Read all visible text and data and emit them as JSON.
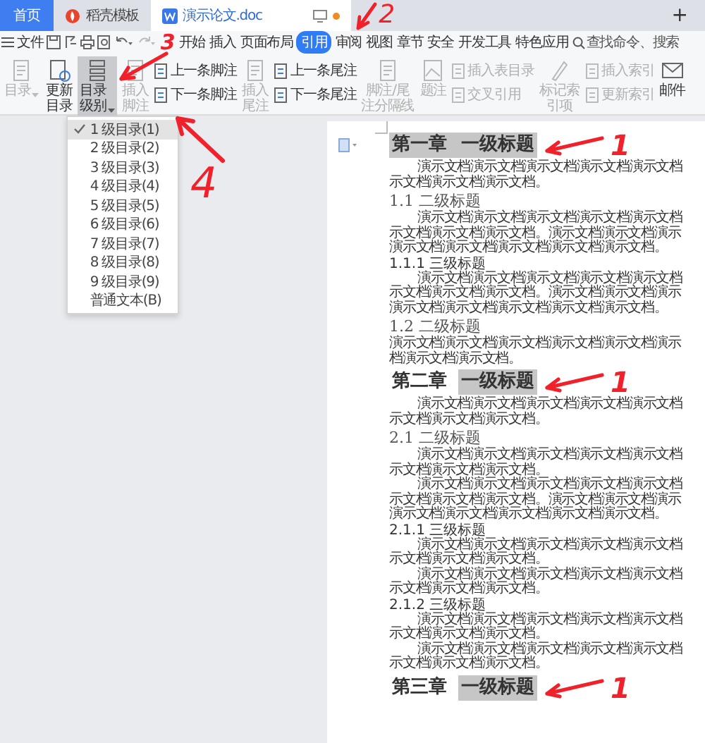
{
  "window_tabs": [
    {
      "kind": "home",
      "label": "首页",
      "selected": false
    },
    {
      "kind": "template",
      "label": "稻壳模板",
      "selected": false
    },
    {
      "kind": "document",
      "label": "演示论文.doc",
      "selected": true
    }
  ],
  "new_tab": "+",
  "menu": {
    "file": "文件",
    "tabs": [
      {
        "label": "开始",
        "selected": false
      },
      {
        "label": "插入",
        "selected": false
      },
      {
        "label": "页面布局",
        "selected": false
      },
      {
        "label": "引用",
        "selected": true
      },
      {
        "label": "审阅",
        "selected": false
      },
      {
        "label": "视图",
        "selected": false
      },
      {
        "label": "章节",
        "selected": false
      },
      {
        "label": "安全",
        "selected": false
      },
      {
        "label": "开发工具",
        "selected": false
      },
      {
        "label": "特色应用",
        "selected": false
      }
    ],
    "search": {
      "placeholder": "查找命令、搜索"
    }
  },
  "ribbon": [
    {
      "kind": "large",
      "label": "目录",
      "disabled": true,
      "pressed": false,
      "dropdown": true
    },
    {
      "kind": "large",
      "label": "更新目录",
      "disabled": false,
      "pressed": false,
      "dropdown": false
    },
    {
      "kind": "large",
      "label": "目录级别",
      "disabled": false,
      "pressed": true,
      "dropdown": true
    },
    {
      "kind": "large",
      "label": "插入脚注",
      "disabled": true,
      "pressed": false,
      "dropdown": false
    },
    {
      "kind": "stack",
      "items": [
        {
          "label": "上一条脚注",
          "disabled": false
        },
        {
          "label": "下一条脚注",
          "disabled": false
        }
      ]
    },
    {
      "kind": "large",
      "label": "插入尾注",
      "disabled": true,
      "pressed": false,
      "dropdown": false
    },
    {
      "kind": "stack",
      "items": [
        {
          "label": "上一条尾注",
          "disabled": false
        },
        {
          "label": "下一条尾注",
          "disabled": false
        }
      ]
    },
    {
      "kind": "large",
      "label": "脚注/尾注分隔线",
      "disabled": true,
      "pressed": false,
      "dropdown": false
    },
    {
      "kind": "large",
      "label": "题注",
      "disabled": true,
      "pressed": false,
      "dropdown": false
    },
    {
      "kind": "stack",
      "items": [
        {
          "label": "插入表目录",
          "disabled": true
        },
        {
          "label": "交叉引用",
          "disabled": true
        }
      ]
    },
    {
      "kind": "large",
      "label": "标记索引项",
      "disabled": true,
      "pressed": false,
      "dropdown": false
    },
    {
      "kind": "stack",
      "items": [
        {
          "label": "插入索引",
          "disabled": true
        },
        {
          "label": "更新索引",
          "disabled": true
        }
      ]
    },
    {
      "kind": "large",
      "label": "邮件",
      "disabled": false,
      "pressed": false,
      "dropdown": false
    }
  ],
  "toc_level_menu": {
    "items": [
      {
        "label": "1 级目录(1)",
        "checked": true
      },
      {
        "label": "2 级目录(2)",
        "checked": false
      },
      {
        "label": "3 级目录(3)",
        "checked": false
      },
      {
        "label": "4 级目录(4)",
        "checked": false
      },
      {
        "label": "5 级目录(5)",
        "checked": false
      },
      {
        "label": "6 级目录(6)",
        "checked": false
      },
      {
        "label": "7 级目录(7)",
        "checked": false
      },
      {
        "label": "8 级目录(8)",
        "checked": false
      },
      {
        "label": "9 级目录(9)",
        "checked": false
      },
      {
        "label": "普通文本(B)",
        "checked": false
      }
    ]
  },
  "document": {
    "blocks": [
      {
        "kind": "h1",
        "number": "第一章",
        "title": "一级标题",
        "number_highlighted": true,
        "annotation": "1"
      },
      {
        "kind": "p",
        "indent": true,
        "lines": [
          "演示文档演示文档演示文档演示文档演示文档",
          "示文档演示文档演示文档。"
        ]
      },
      {
        "kind": "h2",
        "text": "1.1 二级标题"
      },
      {
        "kind": "p",
        "indent": true,
        "lines": [
          "演示文档演示文档演示文档演示文档演示文档",
          "示文档演示文档演示文档。演示文档演示文档演示",
          "演示文档演示文档演示文档演示文档演示文档。"
        ]
      },
      {
        "kind": "h3",
        "text": "1.1.1 三级标题"
      },
      {
        "kind": "p",
        "indent": true,
        "lines": [
          "演示文档演示文档演示文档演示文档演示文档",
          "示文档演示文档演示文档。演示文档演示文档演示",
          "演示文档演示文档演示文档演示文档演示文档。"
        ]
      },
      {
        "kind": "h2",
        "text": "1.2 二级标题"
      },
      {
        "kind": "p",
        "indent": false,
        "lines": [
          "演示文档演示文档演示文档演示文档演示文档演示",
          "档演示文档演示文档。"
        ]
      },
      {
        "kind": "h1",
        "number": "第二章",
        "title": "一级标题",
        "number_highlighted": false,
        "annotation": "1"
      },
      {
        "kind": "p",
        "indent": true,
        "lines": [
          "演示文档演示文档演示文档演示文档演示文档",
          "示文档演示文档演示文档。"
        ]
      },
      {
        "kind": "h2",
        "text": "2.1 二级标题"
      },
      {
        "kind": "p",
        "indent": true,
        "lines": [
          "演示文档演示文档演示文档演示文档演示文档",
          "示文档演示文档演示文档。"
        ]
      },
      {
        "kind": "p",
        "indent": true,
        "lines": [
          "演示文档演示文档演示文档演示文档演示文档",
          "示文档演示文档演示文档。演示文档演示文档演示",
          "演示文档演示文档演示文档演示文档演示文档。"
        ]
      },
      {
        "kind": "h3",
        "text": "2.1.1 三级标题"
      },
      {
        "kind": "p",
        "indent": true,
        "lines": [
          "演示文档演示文档演示文档演示文档演示文档",
          "示文档演示文档演示文档。"
        ]
      },
      {
        "kind": "p",
        "indent": true,
        "lines": [
          "演示文档演示文档演示文档演示文档演示文档",
          "示文档演示文档演示文档。"
        ]
      },
      {
        "kind": "h3",
        "text": "2.1.2 三级标题"
      },
      {
        "kind": "p",
        "indent": true,
        "lines": [
          "演示文档演示文档演示文档演示文档演示文档",
          "示文档演示文档演示文档。"
        ]
      },
      {
        "kind": "p",
        "indent": true,
        "lines": [
          "演示文档演示文档演示文档演示文档演示文档",
          "示文档演示文档演示文档。"
        ]
      },
      {
        "kind": "h1",
        "number": "第三章",
        "title": "一级标题",
        "number_highlighted": false,
        "annotation": "1"
      }
    ]
  },
  "annotations": {
    "tabs": "2",
    "ribbon": "3",
    "menu": "4"
  }
}
